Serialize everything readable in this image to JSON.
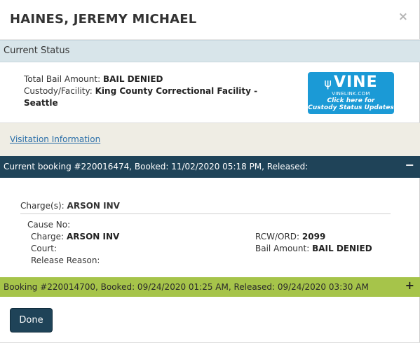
{
  "header": {
    "title": "HAINES, JEREMY MICHAEL",
    "close_label": "×"
  },
  "current_status": {
    "heading": "Current Status",
    "bail_label": "Total Bail Amount:",
    "bail_value": "BAIL DENIED",
    "custody_label": "Custody/Facility:",
    "custody_value_line1": "King County Correctional Facility -",
    "custody_value_line2": "Seattle"
  },
  "vine": {
    "logo_text": "VINE",
    "url_text": "VINELINK.COM",
    "cta_line1": "Click here for",
    "cta_line2": "Custody Status Updates",
    "color": "#1b9ad6"
  },
  "visitation": {
    "link_label": "Visitation Information"
  },
  "current_booking": {
    "header": "Current booking #220016474, Booked: 11/02/2020 05:18 PM, Released:",
    "toggle": "−",
    "charges_label": "Charge(s):",
    "charges_value": "ARSON INV",
    "cause_label": "Cause No:",
    "charge_label": "Charge:",
    "charge_value": "ARSON INV",
    "court_label": "Court:",
    "release_label": "Release Reason:",
    "rcw_label": "RCW/ORD:",
    "rcw_value": "2099",
    "bail_label": "Bail Amount:",
    "bail_value": "BAIL DENIED"
  },
  "previous_booking": {
    "header": "Booking #220014700, Booked: 09/24/2020 01:25 AM, Released: 09/24/2020 03:30 AM",
    "toggle": "+"
  },
  "footer": {
    "done_label": "Done"
  },
  "colors": {
    "dark_bar": "#1f4358",
    "green_bar": "#a6c44a",
    "status_bar": "#d8e5ea",
    "visit_bar": "#efede4"
  }
}
